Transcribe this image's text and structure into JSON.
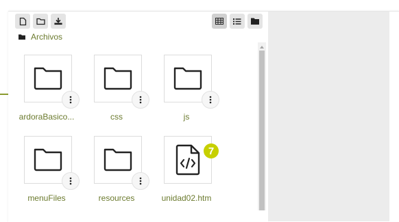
{
  "toolbar": {
    "left_buttons": [
      {
        "icon": "new-file-icon"
      },
      {
        "icon": "new-folder-icon"
      },
      {
        "icon": "download-icon"
      }
    ],
    "right_buttons": [
      {
        "icon": "grid-view-icon",
        "active": true
      },
      {
        "icon": "list-view-icon",
        "active": false
      },
      {
        "icon": "folder-tree-icon",
        "active": false
      }
    ]
  },
  "breadcrumb": {
    "label": "Archivos"
  },
  "files": [
    {
      "name": "ardoraBasico...",
      "type": "folder"
    },
    {
      "name": "css",
      "type": "folder"
    },
    {
      "name": "js",
      "type": "folder"
    },
    {
      "name": "menuFiles",
      "type": "folder"
    },
    {
      "name": "resources",
      "type": "folder"
    },
    {
      "name": "unidad02.htm",
      "type": "code-file",
      "badge": "7"
    }
  ],
  "colors": {
    "accent": "#6b7a2e",
    "badge": "#c7d000",
    "preview_bg": "#ececec"
  }
}
